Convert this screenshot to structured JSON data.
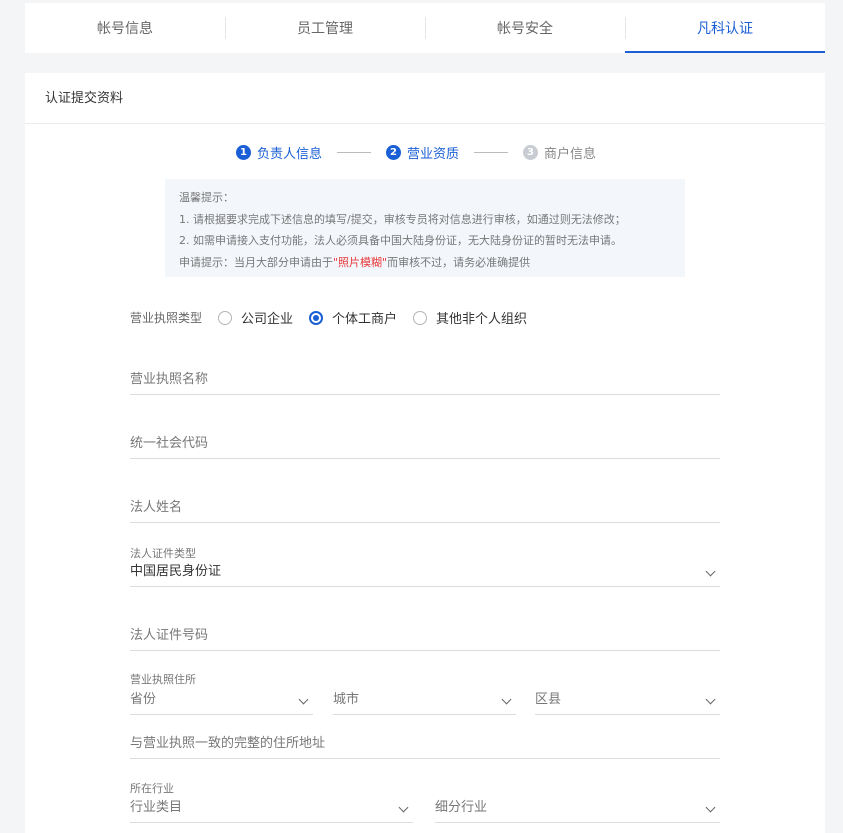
{
  "tabs": [
    {
      "label": "帐号信息",
      "active": false
    },
    {
      "label": "员工管理",
      "active": false
    },
    {
      "label": "帐号安全",
      "active": false
    },
    {
      "label": "凡科认证",
      "active": true
    }
  ],
  "card_title": "认证提交资料",
  "steps": [
    {
      "num": "1",
      "label": "负责人信息",
      "state": "done"
    },
    {
      "num": "2",
      "label": "营业资质",
      "state": "current"
    },
    {
      "num": "3",
      "label": "商户信息",
      "state": "todo"
    }
  ],
  "notice": {
    "title": "温馨提示：",
    "line1": "1. 请根据要求完成下述信息的填写/提交，审核专员将对信息进行审核，如通过则无法修改；",
    "line2": "2. 如需申请接入支付功能，法人必须具备中国大陆身份证，无大陆身份证的暂时无法申请。",
    "line3_prefix": "申请提示：当月大部分申请由于",
    "line3_highlight": "\"照片模糊\"",
    "line3_suffix": "而审核不过，请务必准确提供"
  },
  "license_type": {
    "label": "营业执照类型",
    "options": [
      {
        "label": "公司企业",
        "checked": false
      },
      {
        "label": "个体工商户",
        "checked": true
      },
      {
        "label": "其他非个人组织",
        "checked": false
      }
    ]
  },
  "fields": {
    "license_name": "营业执照名称",
    "credit_code": "统一社会代码",
    "legal_name": "法人姓名",
    "id_type_label": "法人证件类型",
    "id_type_value": "中国居民身份证",
    "id_number": "法人证件号码",
    "address_label": "营业执照住所",
    "province": "省份",
    "city": "城市",
    "district": "区县",
    "full_address": "与营业执照一致的完整的住所地址",
    "industry_label": "所在行业",
    "industry_category": "行业类目",
    "industry_sub": "细分行业"
  },
  "colors": {
    "accent": "#1a5fd6",
    "warning": "#e83a3a",
    "notice_bg": "#f3f7fc"
  }
}
